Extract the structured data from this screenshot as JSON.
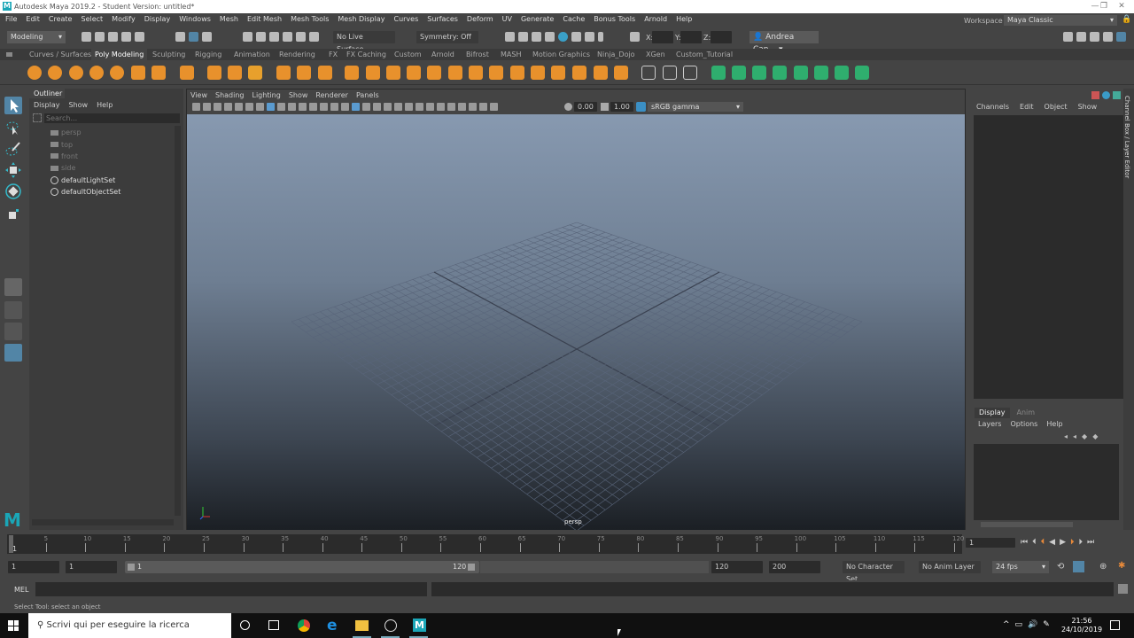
{
  "title": "Autodesk Maya 2019.2 - Student Version: untitled*",
  "menu": [
    "File",
    "Edit",
    "Create",
    "Select",
    "Modify",
    "Display",
    "Windows",
    "Mesh",
    "Edit Mesh",
    "Mesh Tools",
    "Mesh Display",
    "Curves",
    "Surfaces",
    "Deform",
    "UV",
    "Generate",
    "Cache",
    "Bonus Tools",
    "Arnold",
    "Help"
  ],
  "status": {
    "mode": "Modeling",
    "live_surface": "No Live Surface",
    "symmetry": "Symmetry: Off",
    "x_label": "X:",
    "y_label": "Y:",
    "z_label": "Z:",
    "user": "Andrea Can...",
    "workspace_label": "Workspace :",
    "workspace": "Maya Classic"
  },
  "shelf_tabs": [
    "Curves / Surfaces",
    "Poly Modeling",
    "Sculpting",
    "Rigging",
    "Animation",
    "Rendering",
    "FX",
    "FX Caching",
    "Custom",
    "Arnold",
    "Bifrost",
    "MASH",
    "Motion Graphics",
    "Ninja_Dojo",
    "XGen",
    "Custom_Tutorial"
  ],
  "active_shelf": "Poly Modeling",
  "outliner": {
    "tab": "Outliner",
    "menu": [
      "Display",
      "Show",
      "Help"
    ],
    "search_placeholder": "Search...",
    "items": [
      {
        "name": "persp",
        "type": "camera",
        "dim": true
      },
      {
        "name": "top",
        "type": "camera",
        "dim": true
      },
      {
        "name": "front",
        "type": "camera",
        "dim": true
      },
      {
        "name": "side",
        "type": "camera",
        "dim": true
      },
      {
        "name": "defaultLightSet",
        "type": "set",
        "dim": false
      },
      {
        "name": "defaultObjectSet",
        "type": "set",
        "dim": false
      }
    ]
  },
  "viewport": {
    "menu": [
      "View",
      "Shading",
      "Lighting",
      "Show",
      "Renderer",
      "Panels"
    ],
    "exposure": "0.00",
    "gamma": "1.00",
    "color_space": "sRGB gamma",
    "camera_label": "persp"
  },
  "channel_box": {
    "menu": [
      "Channels",
      "Edit",
      "Object",
      "Show"
    ],
    "side_label": "Channel Box / Layer Editor"
  },
  "layer_editor": {
    "tabs": [
      "Display",
      "Anim"
    ],
    "menu": [
      "Layers",
      "Options",
      "Help"
    ]
  },
  "timeline": {
    "start": 1,
    "end": 120,
    "current": 1,
    "tick_labels": [
      5,
      10,
      15,
      20,
      25,
      30,
      35,
      40,
      45,
      50,
      55,
      60,
      65,
      70,
      75,
      80,
      85,
      90,
      95,
      100,
      105,
      110,
      115,
      120
    ],
    "current_field": "1"
  },
  "range": {
    "start": "1",
    "anim_start": "1",
    "slider_start": "1",
    "slider_end": "120",
    "end": "120",
    "anim_end": "200",
    "character_set": "No Character Set",
    "anim_layer": "No Anim Layer",
    "fps": "24 fps"
  },
  "command": {
    "label": "MEL"
  },
  "help_line": "Select Tool: select an object",
  "taskbar": {
    "search_placeholder": "Scrivi qui per eseguire la ricerca",
    "time": "21:56",
    "date": "24/10/2019"
  },
  "colors": {
    "accent": "#5285a6",
    "shelf_orange": "#e8912c",
    "shelf_green": "#2fae6e"
  }
}
